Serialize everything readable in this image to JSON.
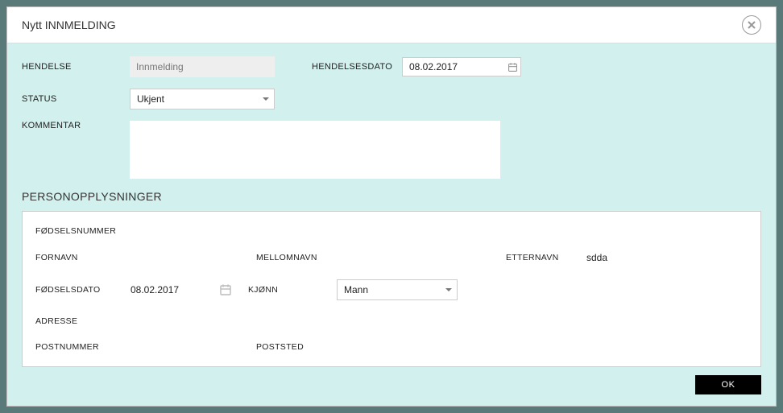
{
  "modal": {
    "title": "Nytt INNMELDING"
  },
  "form": {
    "hendelse_label": "HENDELSE",
    "hendelse_value": "Innmelding",
    "hendelsesdato_label": "HENDELSESDATO",
    "hendelsesdato_value": "08.02.2017",
    "status_label": "STATUS",
    "status_value": "Ukjent",
    "kommentar_label": "KOMMENTAR",
    "kommentar_value": ""
  },
  "section": {
    "title": "PERSONOPPLYSNINGER"
  },
  "person": {
    "fodselsnummer_label": "FØDSELSNUMMER",
    "fodselsnummer_value": "",
    "fornavn_label": "FORNAVN",
    "fornavn_value": "",
    "mellomnavn_label": "MELLOMNAVN",
    "mellomnavn_value": "",
    "etternavn_label": "ETTERNAVN",
    "etternavn_value": "sdda",
    "fodselsdato_label": "FØDSELSDATO",
    "fodselsdato_value": "08.02.2017",
    "kjonn_label": "KJØNN",
    "kjonn_value": "Mann",
    "adresse_label": "ADRESSE",
    "adresse_value": "",
    "postnummer_label": "POSTNUMMER",
    "postnummer_value": "",
    "poststed_label": "POSTSTED",
    "poststed_value": ""
  },
  "buttons": {
    "ok": "OK"
  }
}
